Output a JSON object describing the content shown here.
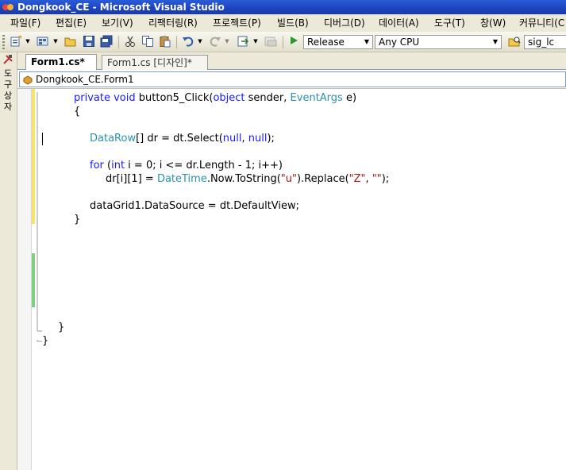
{
  "window": {
    "title": "Dongkook_CE - Microsoft Visual Studio"
  },
  "menu": [
    "파일(F)",
    "편집(E)",
    "보기(V)",
    "리팩터링(R)",
    "프로젝트(P)",
    "빌드(B)",
    "디버그(D)",
    "데이터(A)",
    "도구(T)",
    "창(W)",
    "커뮤니티(C"
  ],
  "toolbar": {
    "configuration": "Release",
    "platform": "Any CPU",
    "find_text": "sig_lc",
    "icons": [
      "add-item-icon",
      "new-project-icon",
      "open-file-icon",
      "save-icon",
      "save-all-icon",
      "cut-icon",
      "copy-icon",
      "paste-icon",
      "undo-icon",
      "redo-icon",
      "navigate-icon",
      "navigate-back-icon",
      "start-debugging-icon",
      "find-in-files-icon"
    ]
  },
  "toolbox": {
    "label": "도구 상자"
  },
  "tabs": [
    {
      "label": "Form1.cs*",
      "active": true
    },
    {
      "label": "Form1.cs [디자인]*",
      "active": false
    }
  ],
  "navigation": {
    "type_selector": "Dongkook_CE.Form1"
  },
  "code": {
    "lines": [
      [
        [
          "kw",
          "private"
        ],
        [
          "pl",
          " "
        ],
        [
          "kw",
          "void"
        ],
        [
          "pl",
          " button5_Click("
        ],
        [
          "kw",
          "object"
        ],
        [
          "pl",
          " sender, "
        ],
        [
          "ty",
          "EventArgs"
        ],
        [
          "pl",
          " e)"
        ]
      ],
      [
        [
          "pl",
          "{"
        ]
      ],
      [
        [
          "pl",
          ""
        ]
      ],
      [
        [
          "ty",
          "DataRow"
        ],
        [
          "pl",
          "[] dr = dt.Select("
        ],
        [
          "kw",
          "null"
        ],
        [
          "pl",
          ", "
        ],
        [
          "kw",
          "null"
        ],
        [
          "pl",
          ");"
        ]
      ],
      [
        [
          "pl",
          ""
        ]
      ],
      [
        [
          "kw",
          "for"
        ],
        [
          "pl",
          " ("
        ],
        [
          "kw",
          "int"
        ],
        [
          "pl",
          " i = 0; i <= dr.Length - 1; i++)"
        ]
      ],
      [
        [
          "pl",
          "dr[i][1] = "
        ],
        [
          "ty",
          "DateTime"
        ],
        [
          "pl",
          ".Now.ToString("
        ],
        [
          "st",
          "\"u\""
        ],
        [
          "pl",
          ").Replace("
        ],
        [
          "st",
          "\"Z\""
        ],
        [
          "pl",
          ", "
        ],
        [
          "st",
          "\"\""
        ],
        [
          "pl",
          ");"
        ]
      ],
      [
        [
          "pl",
          ""
        ]
      ],
      [
        [
          "pl",
          "dataGrid1.DataSource = dt.DefaultView;"
        ]
      ],
      [
        [
          "pl",
          "}"
        ]
      ],
      [
        [
          "pl",
          ""
        ]
      ],
      [
        [
          "pl",
          ""
        ]
      ],
      [
        [
          "pl",
          ""
        ]
      ],
      [
        [
          "pl",
          ""
        ]
      ],
      [
        [
          "pl",
          ""
        ]
      ],
      [
        [
          "pl",
          ""
        ]
      ],
      [
        [
          "pl",
          ""
        ]
      ],
      [
        [
          "pl",
          "}"
        ]
      ],
      [
        [
          "pl",
          "}"
        ]
      ]
    ]
  },
  "colors": {
    "keyword": "#1a1aff",
    "type": "#2b91af",
    "string": "#a31515",
    "title_bar": "#1e45c0",
    "changed_unsaved": "#f5e36a",
    "changed_saved": "#7ed07e"
  }
}
